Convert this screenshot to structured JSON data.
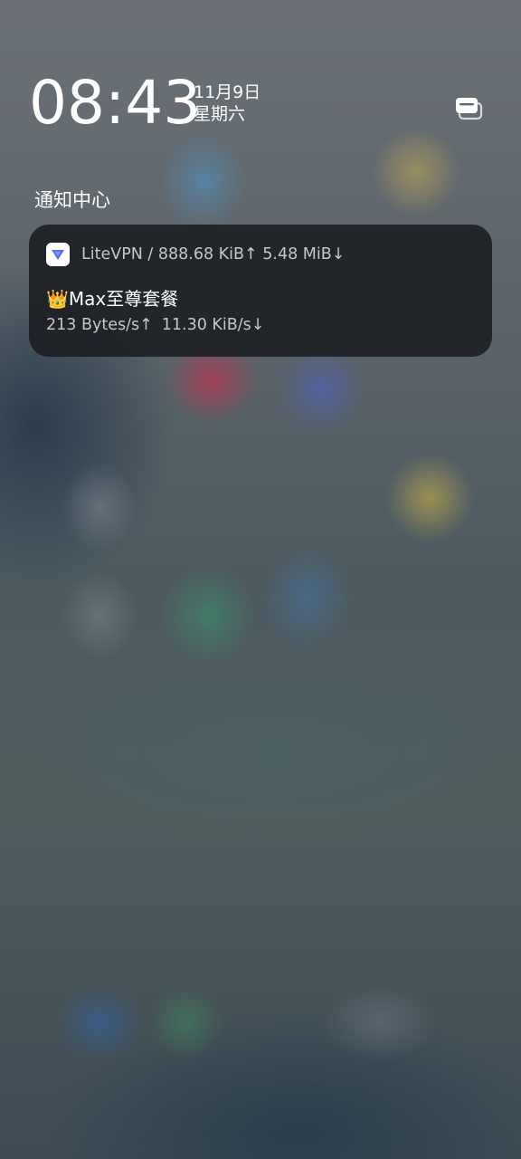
{
  "lockscreen": {
    "time": "08:43",
    "date": "11月9日",
    "weekday": "星期六"
  },
  "notification_center": {
    "title": "通知中心",
    "manage_icon": "notification-manage-icon"
  },
  "notification": {
    "app_icon": "litevpn-logo-icon",
    "app_name": "LiteVPN",
    "separator": " / ",
    "traffic_up": "888.68 KiB↑",
    "traffic_down": "5.48 MiB↓",
    "title_emoji": "👑",
    "title_text": "Max至尊套餐",
    "speed_up": "213 Bytes/s↑",
    "speed_down": "11.30 KiB/s↓"
  },
  "colors": {
    "card_background": "#1a1d21",
    "secondary_text": "#c4c6c9",
    "app_icon_accent": "#6a4dff"
  }
}
